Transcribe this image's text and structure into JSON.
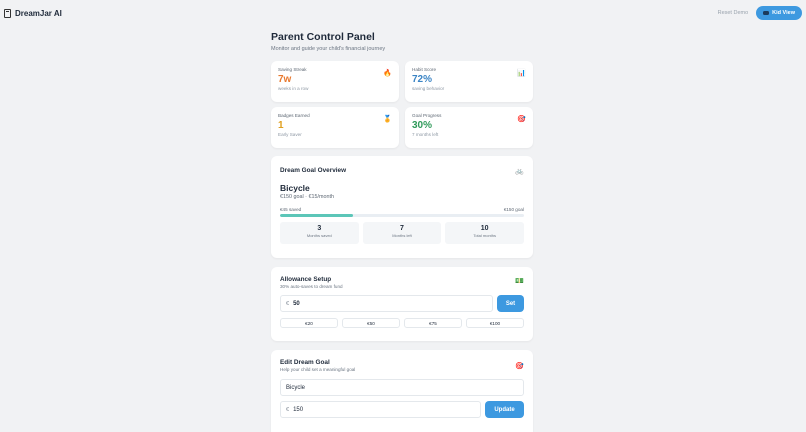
{
  "app": {
    "name": "DreamJar AI"
  },
  "topbar": {
    "reset_label": "Reset Demo",
    "kid_view_label": "Kid View"
  },
  "page": {
    "title": "Parent Control Panel",
    "subtitle": "Monitor and guide your child's financial journey"
  },
  "stats": [
    {
      "label": "Saving Streak",
      "value": "7w",
      "sub": "weeks in a row",
      "icon": "fire-icon",
      "glyph": "🔥",
      "color": "#e8792f"
    },
    {
      "label": "Habit Score",
      "value": "72%",
      "sub": "saving behavior",
      "icon": "bar-chart-icon",
      "glyph": "📊",
      "color": "#3a84c5"
    },
    {
      "label": "Badges Earned",
      "value": "1",
      "sub": "Early Saver",
      "icon": "medal-icon",
      "glyph": "🏅",
      "color": "#e0a020"
    },
    {
      "label": "Goal Progress",
      "value": "30%",
      "sub": "7 months left",
      "icon": "target-icon",
      "glyph": "🎯",
      "color": "#2f9a5a"
    }
  ],
  "dream_goal": {
    "title": "Dream Goal Overview",
    "icon": "bicycle-icon",
    "glyph": "🚲",
    "name": "Bicycle",
    "meta": "€150 goal · €15/month",
    "saved_label": "€45 saved",
    "goal_label": "€150 goal",
    "progress": 0.3,
    "boxes": [
      {
        "num": "3",
        "label": "Months saved"
      },
      {
        "num": "7",
        "label": "Months left"
      },
      {
        "num": "10",
        "label": "Total months"
      }
    ]
  },
  "allowance": {
    "title": "Allowance Setup",
    "subtitle": "30% auto-saves to dream fund",
    "icon": "money-icon",
    "glyph": "💵",
    "currency": "€",
    "value": "50",
    "set_label": "Set",
    "presets": [
      "€20",
      "€50",
      "€75",
      "€100"
    ]
  },
  "edit_goal": {
    "title": "Edit Dream Goal",
    "subtitle": "Help your child set a meaningful goal",
    "icon": "target-icon",
    "glyph": "🎯",
    "goal_name": "Bicycle",
    "currency": "€",
    "amount": "150",
    "update_label": "Update"
  }
}
